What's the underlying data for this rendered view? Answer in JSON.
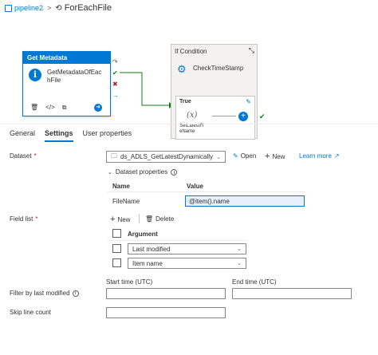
{
  "breadcrumb": {
    "pipeline": "pipeline2",
    "separator": ">",
    "current": "ForEachFile"
  },
  "activities": {
    "get_metadata": {
      "header": "Get Metadata",
      "name_line1": "GetMetadataOfEac",
      "name_line2": "hFile"
    },
    "if_condition": {
      "header": "If Condition",
      "name": "CheckTimeStamp",
      "true_label": "True",
      "variable_line1": "SetLatestFi",
      "variable_line2": "eName"
    }
  },
  "tabs": [
    "General",
    "Settings",
    "User properties"
  ],
  "active_tab": "Settings",
  "settings": {
    "dataset_label": "Dataset",
    "dataset_value": "ds_ADLS_GetLatestDynamically",
    "open_label": "Open",
    "new_label": "New",
    "learn_more_label": "Learn more",
    "dataset_properties_label": "Dataset properties",
    "dp_name_header": "Name",
    "dp_value_header": "Value",
    "dp_row_name": "FileName",
    "dp_row_value": "@item().name",
    "field_list_label": "Field list",
    "field_new_label": "New",
    "field_delete_label": "Delete",
    "argument_header": "Argument",
    "arguments": [
      "Last modified",
      "Item name"
    ],
    "filter_label": "Filter by last modified",
    "start_time_label": "Start time (UTC)",
    "end_time_label": "End time (UTC)",
    "skip_label": "Skip line count"
  },
  "colors": {
    "accent": "#0078d4",
    "success": "#107c10",
    "failure": "#a4262c"
  }
}
